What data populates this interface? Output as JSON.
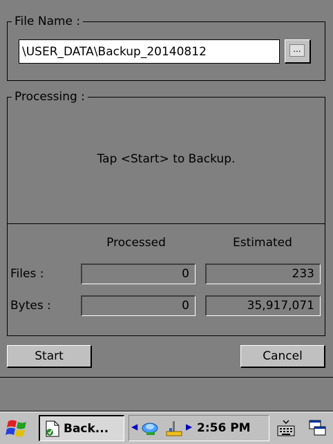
{
  "file_group": {
    "legend": "File Name :",
    "path_value": "\\USER_DATA\\Backup_20140812",
    "browse_label": "..."
  },
  "processing_group": {
    "legend": "Processing :",
    "message": "Tap <Start> to Backup.",
    "col_processed": "Processed",
    "col_estimated": "Estimated",
    "rows": [
      {
        "label": "Files :",
        "processed": "0",
        "estimated": "233"
      },
      {
        "label": "Bytes :",
        "processed": "0",
        "estimated": "35,917,071"
      }
    ]
  },
  "buttons": {
    "start": "Start",
    "cancel": "Cancel"
  },
  "taskbar": {
    "start_icon": "windows-flag-icon",
    "app_button_label": "Back...",
    "app_icon": "document-icon",
    "time": "2:56 PM",
    "tray_icons": [
      "network-icon",
      "usb-connection-icon",
      "right-arrow-icon"
    ],
    "keyboard_icon": "keyboard-icon",
    "desktop_icon": "windows-cascade-icon"
  }
}
